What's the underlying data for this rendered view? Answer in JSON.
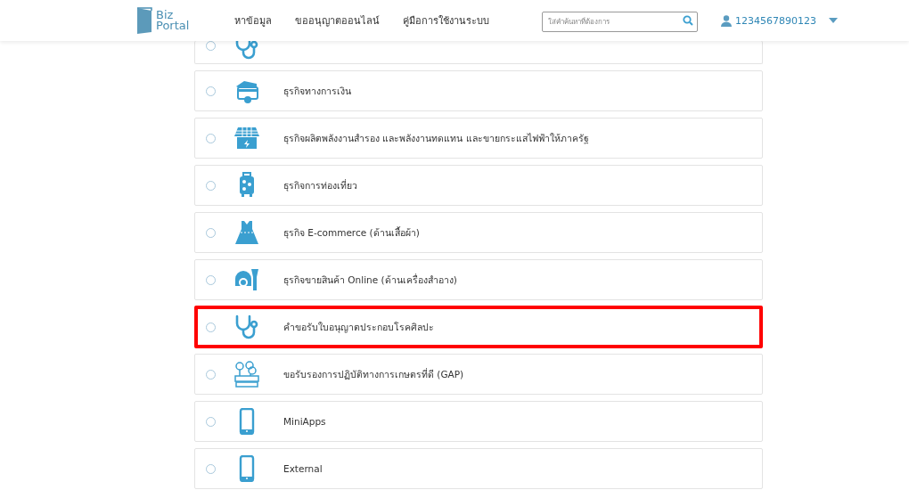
{
  "header": {
    "logo": {
      "line_1": "Biz",
      "line_2": "Portal"
    },
    "nav": [
      "หาข้อมูล",
      "ขออนุญาตออนไลน์",
      "คู่มือการใช้งานระบบ"
    ],
    "search": {
      "placeholder": "ใส่คำค้นหาที่ต้องการ"
    },
    "user": {
      "name": "1234567890123"
    }
  },
  "items": [
    {
      "kind": "stethoscope",
      "selected": false,
      "highlighted": false
    },
    {
      "label": "ธุรกิจทางการเงิน",
      "kind": "finance",
      "selected": false,
      "highlighted": false
    },
    {
      "label": "ธุรกิจผลิตพลังงานสำรอง และพลังงานทดแทน และขายกระแสไฟฟ้าให้ภาครัฐ",
      "kind": "solar",
      "selected": false,
      "highlighted": false
    },
    {
      "label": "ธุรกิจการท่องเที่ยว",
      "kind": "luggage",
      "selected": false,
      "highlighted": false
    },
    {
      "label": "ธุรกิจ E-commerce (ด้านเสื้อผ้า)",
      "kind": "dress",
      "selected": false,
      "highlighted": false
    },
    {
      "label": "ธุรกิจขายสินค้า Online (ด้านเครื่องสำอาง)",
      "kind": "cosmetics",
      "selected": false,
      "highlighted": false
    },
    {
      "label": "คำขอรับใบอนุญาตประกอบโรคศิลปะ",
      "kind": "stethoscope",
      "selected": false,
      "highlighted": true
    },
    {
      "label": "ขอรับรองการปฏิบัติทางการเกษตรที่ดี (GAP)",
      "kind": "farm",
      "selected": false,
      "highlighted": false
    },
    {
      "label": "MiniApps",
      "kind": "phone",
      "selected": false,
      "highlighted": false
    },
    {
      "label": "External",
      "kind": "phone",
      "selected": false,
      "highlighted": false
    }
  ]
}
